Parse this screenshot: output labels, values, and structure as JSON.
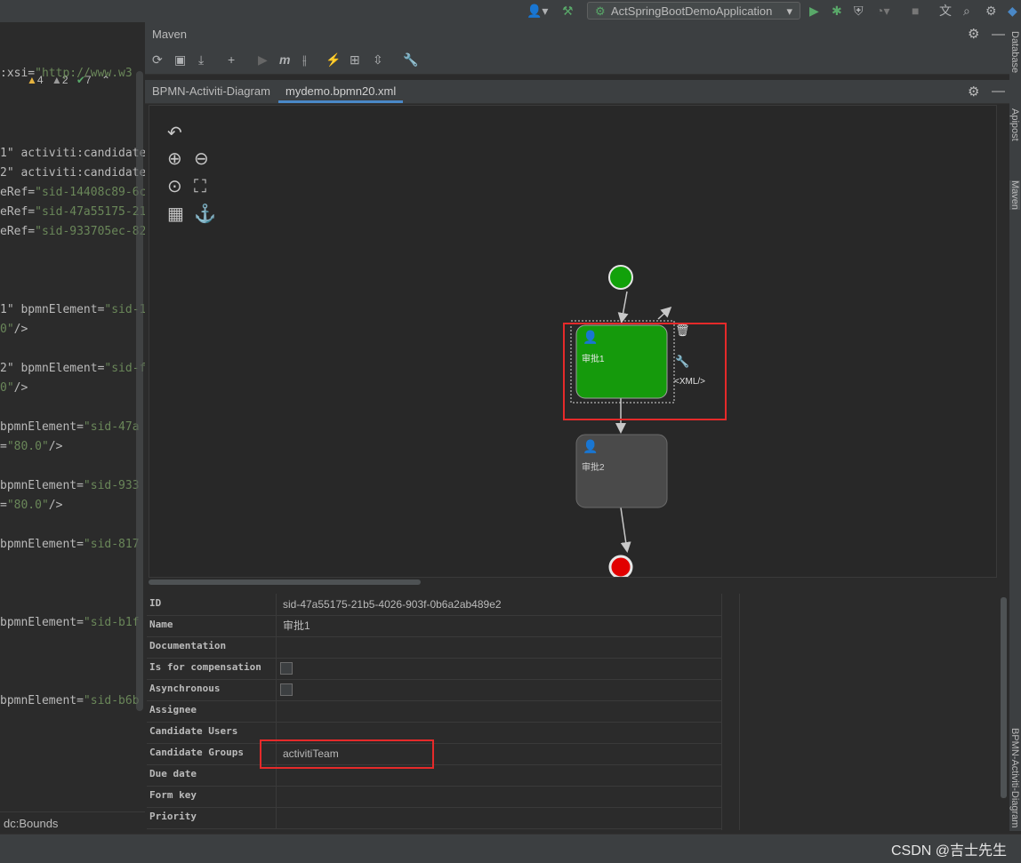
{
  "run_config": "ActSpringBootDemoApplication",
  "inspections": {
    "warnings": "4",
    "weak_warnings": "2",
    "ok": "7"
  },
  "editor_lines": [
    {
      "a": ":xsi=",
      "b": "\"http://www.w3",
      "c": ""
    },
    {
      "a": "1\" activiti:candidate",
      "b": "",
      "c": ""
    },
    {
      "a": "2\" activiti:candidate",
      "b": "",
      "c": ""
    },
    {
      "a": "eRef=",
      "b": "\"sid-14408c89-6c",
      "c": ""
    },
    {
      "a": "eRef=",
      "b": "\"sid-47a55175-21",
      "c": ""
    },
    {
      "a": "eRef=",
      "b": "\"sid-933705ec-82",
      "c": ""
    },
    {
      "a": "1\" bpmnElement=",
      "b": "\"sid-1",
      "c": ""
    },
    {
      "a": "",
      "b": "0\"",
      "c": "/>"
    },
    {
      "a": "2\" bpmnElement=",
      "b": "\"sid-f",
      "c": ""
    },
    {
      "a": "",
      "b": "0\"",
      "c": "/>"
    },
    {
      "a": " bpmnElement=",
      "b": "\"sid-47a",
      "c": ""
    },
    {
      "a": "=",
      "b": "\"80.0\"",
      "c": "/>"
    },
    {
      "a": " bpmnElement=",
      "b": "\"sid-933",
      "c": ""
    },
    {
      "a": "=",
      "b": "\"80.0\"",
      "c": "/>"
    },
    {
      "a": " bpmnElement=",
      "b": "\"sid-817",
      "c": ""
    },
    {
      "a": " bpmnElement=",
      "b": "\"sid-b1f",
      "c": ""
    },
    {
      "a": " bpmnElement=",
      "b": "\"sid-b6b",
      "c": ""
    }
  ],
  "breadcrumb": "dc:Bounds",
  "maven": {
    "title": "Maven"
  },
  "tabs": [
    "BPMN-Activiti-Diagram",
    "mydemo.bpmn20.xml"
  ],
  "diagram": {
    "task1_label": "审批1",
    "task2_label": "审批2",
    "xml_link": "<XML/>"
  },
  "properties": [
    {
      "key": "ID",
      "value": "sid-47a55175-21b5-4026-903f-0b6a2ab489e2",
      "type": "text"
    },
    {
      "key": "Name",
      "value": "审批1",
      "type": "text"
    },
    {
      "key": "Documentation",
      "value": "",
      "type": "text"
    },
    {
      "key": "Is for compensation",
      "value": "",
      "type": "checkbox"
    },
    {
      "key": "Asynchronous",
      "value": "",
      "type": "checkbox"
    },
    {
      "key": "Assignee",
      "value": "",
      "type": "text"
    },
    {
      "key": "Candidate Users",
      "value": "",
      "type": "text"
    },
    {
      "key": "Candidate Groups",
      "value": "activitiTeam",
      "type": "text"
    },
    {
      "key": "Due date",
      "value": "",
      "type": "text"
    },
    {
      "key": "Form key",
      "value": "",
      "type": "text"
    },
    {
      "key": "Priority",
      "value": "",
      "type": "text"
    }
  ],
  "right_strip": {
    "database": "Database",
    "apipost": "Apipost",
    "maven": "Maven",
    "bpmn": "BPMN-Activiti-Diagram"
  },
  "watermark": "CSDN @吉士先生",
  "colors": {
    "accent": "#4a88c7",
    "task_selected": "#159a0c",
    "start_event": "#12a10a",
    "end_event": "#e10000",
    "highlight_box": "#e52a2a"
  }
}
